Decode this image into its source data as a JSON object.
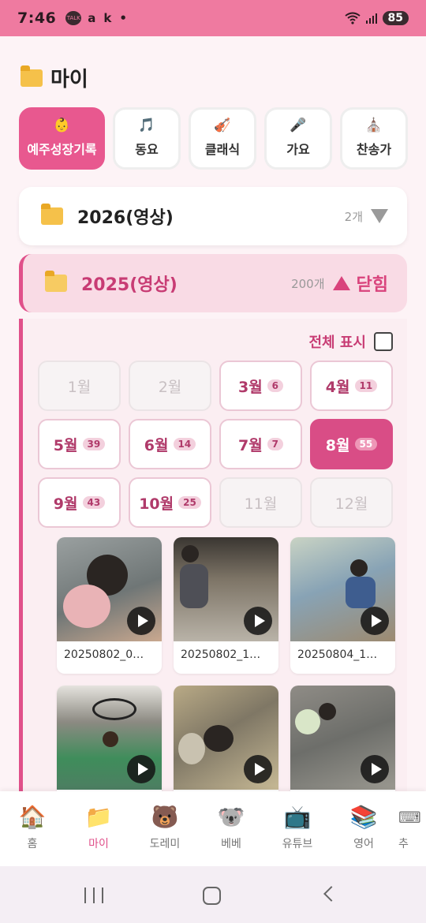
{
  "status_bar": {
    "time": "7:46",
    "talk_badge": "TALK",
    "app_icon_1": "a",
    "app_icon_2": "k",
    "dot": "•",
    "battery": "85"
  },
  "header": {
    "title": "마이"
  },
  "categories": [
    {
      "label": "예주성장기록",
      "icon": "baby-icon",
      "glyph": "👶"
    },
    {
      "label": "동요",
      "icon": "music-note-icon",
      "glyph": "🎵"
    },
    {
      "label": "클래식",
      "icon": "violin-icon",
      "glyph": "🎻"
    },
    {
      "label": "가요",
      "icon": "microphone-icon",
      "glyph": "🎤"
    },
    {
      "label": "찬송가",
      "icon": "church-icon",
      "glyph": "⛪"
    }
  ],
  "years": [
    {
      "label": "2026(영상)",
      "count": "2개",
      "state": "collapsed"
    },
    {
      "label": "2025(영상)",
      "count": "200개",
      "state": "expanded",
      "close_label": "닫힘"
    }
  ],
  "panel": {
    "show_all_label": "전체 표시",
    "months": [
      {
        "label": "1월",
        "count": "",
        "state": "disabled"
      },
      {
        "label": "2월",
        "count": "",
        "state": "disabled"
      },
      {
        "label": "3월",
        "count": "6",
        "state": "normal"
      },
      {
        "label": "4월",
        "count": "11",
        "state": "normal"
      },
      {
        "label": "5월",
        "count": "39",
        "state": "normal"
      },
      {
        "label": "6월",
        "count": "14",
        "state": "normal"
      },
      {
        "label": "7월",
        "count": "7",
        "state": "normal"
      },
      {
        "label": "8월",
        "count": "55",
        "state": "selected"
      },
      {
        "label": "9월",
        "count": "43",
        "state": "normal"
      },
      {
        "label": "10월",
        "count": "25",
        "state": "normal"
      },
      {
        "label": "11월",
        "count": "",
        "state": "disabled"
      },
      {
        "label": "12월",
        "count": "",
        "state": "disabled"
      }
    ],
    "videos": [
      {
        "name": "20250802_0…"
      },
      {
        "name": "20250802_1…"
      },
      {
        "name": "20250804_1…"
      },
      {
        "name": ""
      },
      {
        "name": ""
      },
      {
        "name": ""
      }
    ]
  },
  "bottom_nav": [
    {
      "label": "홈",
      "icon": "house-icon",
      "glyph": "🏠",
      "active": false
    },
    {
      "label": "마이",
      "icon": "folder-icon",
      "glyph": "📁",
      "active": true
    },
    {
      "label": "도레미",
      "icon": "bear-icon",
      "glyph": "🐻",
      "active": false
    },
    {
      "label": "베베",
      "icon": "koala-icon",
      "glyph": "🐨",
      "active": false
    },
    {
      "label": "유튜브",
      "icon": "tv-icon",
      "glyph": "📺",
      "active": false
    },
    {
      "label": "영어",
      "icon": "books-icon",
      "glyph": "📚",
      "active": false
    },
    {
      "label": "추",
      "icon": "keyboard-icon",
      "glyph": "⌨",
      "active": false
    }
  ],
  "colors": {
    "accent": "#e0508a",
    "status_bar": "#ef7aa0",
    "selected_month": "#d94d86"
  }
}
